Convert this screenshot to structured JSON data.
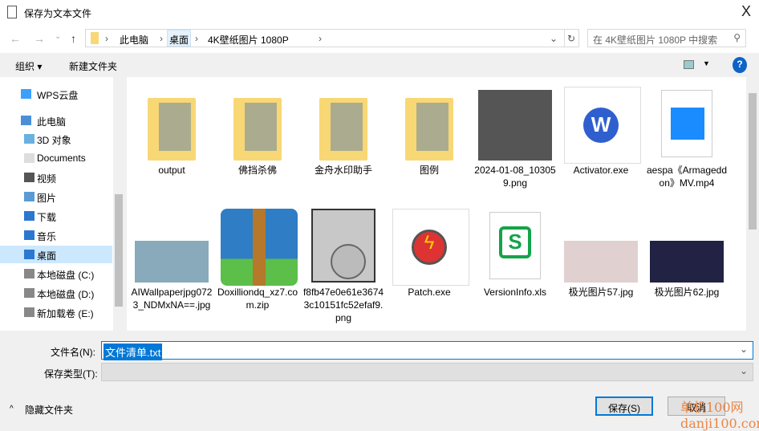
{
  "window": {
    "title": "保存为文本文件",
    "close": "X"
  },
  "nav": {
    "back": "←",
    "forward": "→",
    "recent": "⌄",
    "up": "↑",
    "crumbs": [
      "此电脑",
      "桌面",
      "4K壁纸图片 1080P"
    ],
    "refresh": "↻",
    "search_placeholder": "在 4K壁纸图片 1080P 中搜索"
  },
  "toolbar": {
    "organize": "组织 ▾",
    "new_folder": "新建文件夹",
    "help": "?"
  },
  "sidebar": {
    "items": [
      {
        "label": "WPS云盘",
        "icon": "cloud-icon"
      },
      {
        "label": "此电脑",
        "icon": "computer-icon"
      },
      {
        "label": "3D 对象",
        "icon": "cube-icon"
      },
      {
        "label": "Documents",
        "icon": "document-icon"
      },
      {
        "label": "视频",
        "icon": "video-icon"
      },
      {
        "label": "图片",
        "icon": "picture-icon"
      },
      {
        "label": "下载",
        "icon": "download-icon"
      },
      {
        "label": "音乐",
        "icon": "music-icon"
      },
      {
        "label": "桌面",
        "icon": "desktop-icon",
        "selected": true
      },
      {
        "label": "本地磁盘 (C:)",
        "icon": "drive-icon"
      },
      {
        "label": "本地磁盘 (D:)",
        "icon": "drive-icon"
      },
      {
        "label": "新加载卷 (E:)",
        "icon": "drive-icon"
      }
    ]
  },
  "files": [
    {
      "name": "output",
      "type": "folder"
    },
    {
      "name": "佛挡杀佛",
      "type": "folder"
    },
    {
      "name": "金舟水印助手",
      "type": "folder"
    },
    {
      "name": "图例",
      "type": "folder"
    },
    {
      "name": "2024-01-08_103059.png",
      "type": "image"
    },
    {
      "name": "Activator.exe",
      "type": "exe"
    },
    {
      "name": "aespa《Armageddon》MV.mp4",
      "type": "video"
    },
    {
      "name": "AIWallpaperjpg0723_NDMxNA==.jpg",
      "type": "image"
    },
    {
      "name": "Doxilliondq_xz7.com.zip",
      "type": "zip"
    },
    {
      "name": "f8fb47e0e61e36743c10151fc52efaf9.png",
      "type": "image"
    },
    {
      "name": "Patch.exe",
      "type": "exe"
    },
    {
      "name": "VersionInfo.xls",
      "type": "xls"
    },
    {
      "name": "极光图片57.jpg",
      "type": "image"
    },
    {
      "name": "极光图片62.jpg",
      "type": "image"
    }
  ],
  "form": {
    "filename_label": "文件名(N):",
    "filename_value": "文件清单.txt",
    "filetype_label": "保存类型(T):",
    "filetype_value": ""
  },
  "footer": {
    "hide_folders": "隐藏文件夹",
    "save": "保存(S)",
    "cancel": "取消"
  },
  "watermark": "单机100网 danji100.com",
  "colors": {
    "accent": "#0078d7",
    "selection": "#cce8ff"
  }
}
